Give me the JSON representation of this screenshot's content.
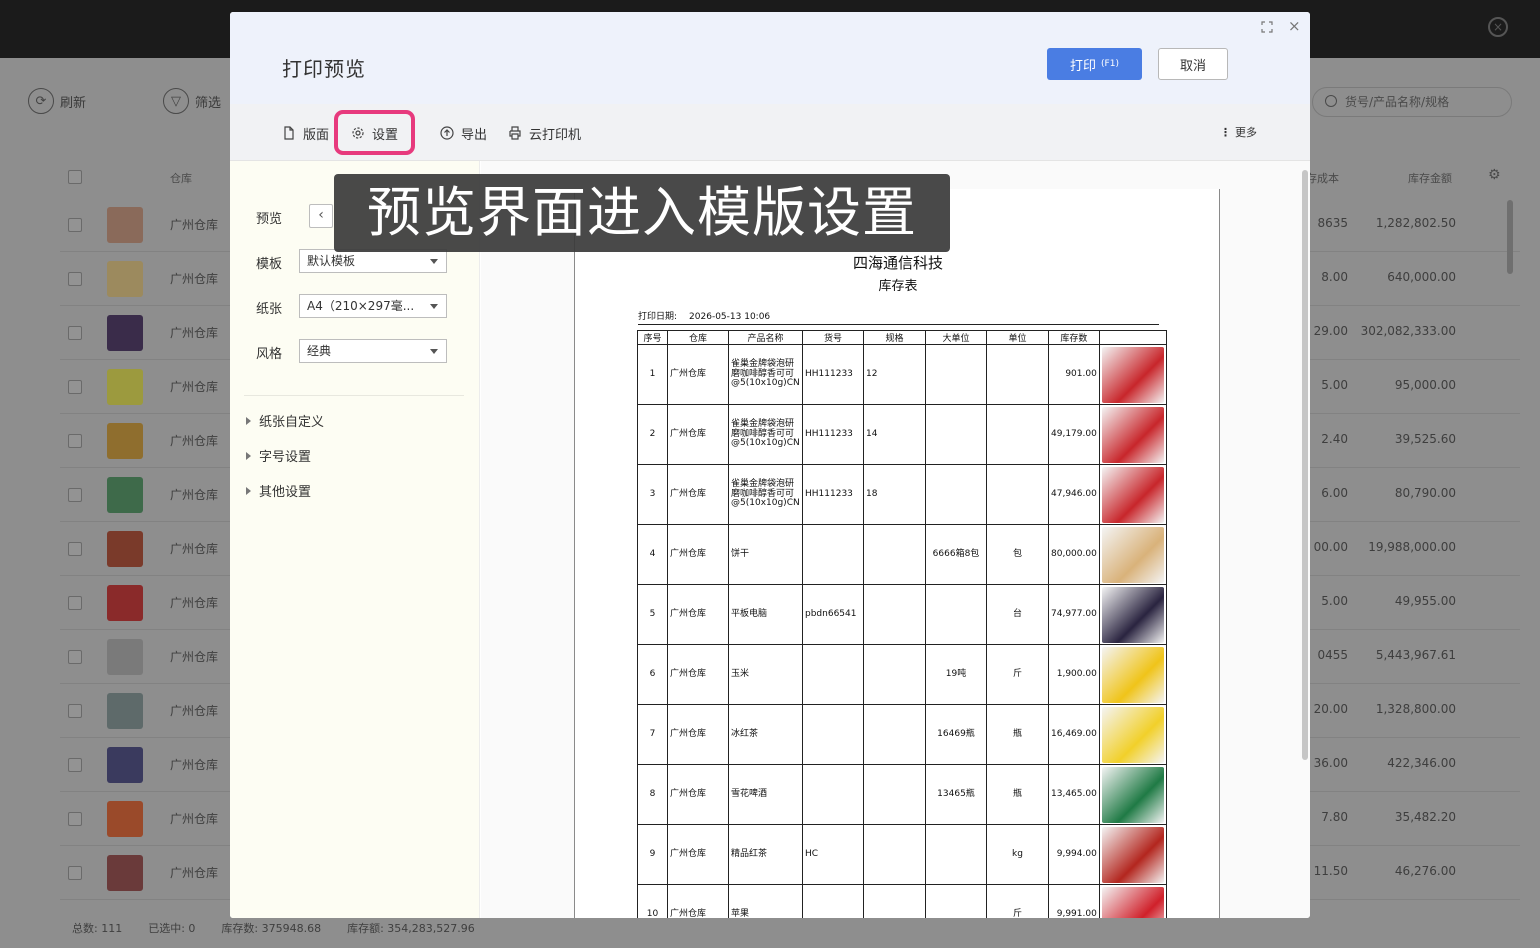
{
  "background": {
    "toolbar": {
      "refresh": "刷新",
      "filter": "筛选"
    },
    "search_placeholder": "货号/产品名称/规格",
    "header": {
      "warehouse": "仓库",
      "cost": "存成本",
      "amount": "库存金额"
    },
    "rows": [
      {
        "warehouse": "广州仓库",
        "cost": "8635",
        "amount": "1,282,802.50",
        "color": "#8a6a5a"
      },
      {
        "warehouse": "广州仓库",
        "cost": "8.00",
        "amount": "640,000.00",
        "color": "#9c8a5e"
      },
      {
        "warehouse": "广州仓库",
        "cost": "29.00",
        "amount": "302,082,333.00",
        "color": "#3a2c4a"
      },
      {
        "warehouse": "广州仓库",
        "cost": "5.00",
        "amount": "95,000.00",
        "color": "#9c9a3e"
      },
      {
        "warehouse": "广州仓库",
        "cost": "2.40",
        "amount": "39,525.60",
        "color": "#8f6e2e"
      },
      {
        "warehouse": "广州仓库",
        "cost": "6.00",
        "amount": "80,790.00",
        "color": "#3e6a4a"
      },
      {
        "warehouse": "广州仓库",
        "cost": "00.00",
        "amount": "19,988,000.00",
        "color": "#7a3a2a"
      },
      {
        "warehouse": "广州仓库",
        "cost": "5.00",
        "amount": "49,955.00",
        "color": "#8a2a2a"
      },
      {
        "warehouse": "广州仓库",
        "cost": "0455",
        "amount": "5,443,967.61",
        "color": "#7a7a7a"
      },
      {
        "warehouse": "广州仓库",
        "cost": "20.00",
        "amount": "1,328,800.00",
        "color": "#5e6a6a"
      },
      {
        "warehouse": "广州仓库",
        "cost": "36.00",
        "amount": "422,346.00",
        "color": "#3a3a5e"
      },
      {
        "warehouse": "广州仓库",
        "cost": "7.80",
        "amount": "35,482.20",
        "color": "#9a4a2a"
      },
      {
        "warehouse": "广州仓库",
        "cost": "11.50",
        "amount": "46,276.00",
        "color": "#6a3a3a"
      }
    ],
    "footer": {
      "total": "总数:  111",
      "selected": "已选中:  0",
      "stock_qty": "库存数:  375948.68",
      "stock_amount": "库存额:  354,283,527.96"
    }
  },
  "modal": {
    "title": "打印预览",
    "print_button": "打印",
    "print_hotkey": "(F1)",
    "cancel_button": "取消",
    "toolbar": {
      "layout": "版面",
      "settings": "设置",
      "export": "导出",
      "cloud_printer": "云打印机",
      "more": "更多"
    },
    "left_panel": {
      "preview_label": "预览",
      "template_label": "模板",
      "template_value": "默认模板",
      "paper_label": "纸张",
      "paper_value": "A4（210×297毫...",
      "style_label": "风格",
      "style_value": "经典",
      "sections": [
        "纸张自定义",
        "字号设置",
        "其他设置"
      ]
    },
    "document": {
      "company": "四海通信科技",
      "title": "库存表",
      "print_date_label": "打印日期:",
      "print_date": "2026-05-13 10:06",
      "headers": [
        "序号",
        "仓库",
        "产品名称",
        "货号",
        "规格",
        "大单位",
        "单位",
        "库存数",
        ""
      ],
      "rows": [
        {
          "no": "1",
          "warehouse": "广州仓库",
          "name": "雀巢金牌袋泡研磨咖啡醇香可可@5(10x10g)CN",
          "sku": "HH111233",
          "spec": "12",
          "big_unit": "",
          "unit": "",
          "qty": "901.00",
          "img": "#c8262b"
        },
        {
          "no": "2",
          "warehouse": "广州仓库",
          "name": "雀巢金牌袋泡研磨咖啡醇香可可@5(10x10g)CN",
          "sku": "HH111233",
          "spec": "14",
          "big_unit": "",
          "unit": "",
          "qty": "49,179.00",
          "img": "#c8262b"
        },
        {
          "no": "3",
          "warehouse": "广州仓库",
          "name": "雀巢金牌袋泡研磨咖啡醇香可可@5(10x10g)CN",
          "sku": "HH111233",
          "spec": "18",
          "big_unit": "",
          "unit": "",
          "qty": "47,946.00",
          "img": "#c8262b"
        },
        {
          "no": "4",
          "warehouse": "广州仓库",
          "name": "饼干",
          "sku": "",
          "spec": "",
          "big_unit": "6666箱8包",
          "unit": "包",
          "qty": "80,000.00",
          "img": "#d9b27a"
        },
        {
          "no": "5",
          "warehouse": "广州仓库",
          "name": "平板电脑",
          "sku": "pbdn66541",
          "spec": "",
          "big_unit": "",
          "unit": "台",
          "qty": "74,977.00",
          "img": "#2a2440"
        },
        {
          "no": "6",
          "warehouse": "广州仓库",
          "name": "玉米",
          "sku": "",
          "spec": "",
          "big_unit": "19吨",
          "unit": "斤",
          "qty": "1,900.00",
          "img": "#f0c419"
        },
        {
          "no": "7",
          "warehouse": "广州仓库",
          "name": "冰红茶",
          "sku": "",
          "spec": "",
          "big_unit": "16469瓶",
          "unit": "瓶",
          "qty": "16,469.00",
          "img": "#f2d02a"
        },
        {
          "no": "8",
          "warehouse": "广州仓库",
          "name": "雪花啤酒",
          "sku": "",
          "spec": "",
          "big_unit": "13465瓶",
          "unit": "瓶",
          "qty": "13,465.00",
          "img": "#1f7a45"
        },
        {
          "no": "9",
          "warehouse": "广州仓库",
          "name": "精品红茶",
          "sku": "HC",
          "spec": "",
          "big_unit": "",
          "unit": "kg",
          "qty": "9,994.00",
          "img": "#b3261e"
        },
        {
          "no": "10",
          "warehouse": "广州仓库",
          "name": "苹果",
          "sku": "",
          "spec": "",
          "big_unit": "",
          "unit": "斤",
          "qty": "9,991.00",
          "img": "#d0202a"
        }
      ]
    }
  },
  "caption": "预览界面进入模版设置",
  "colors": {
    "primary": "#4a7de3",
    "highlight": "#e73a7d",
    "panel_bg": "#fdfdf3",
    "header_bg": "#eef2fb"
  }
}
